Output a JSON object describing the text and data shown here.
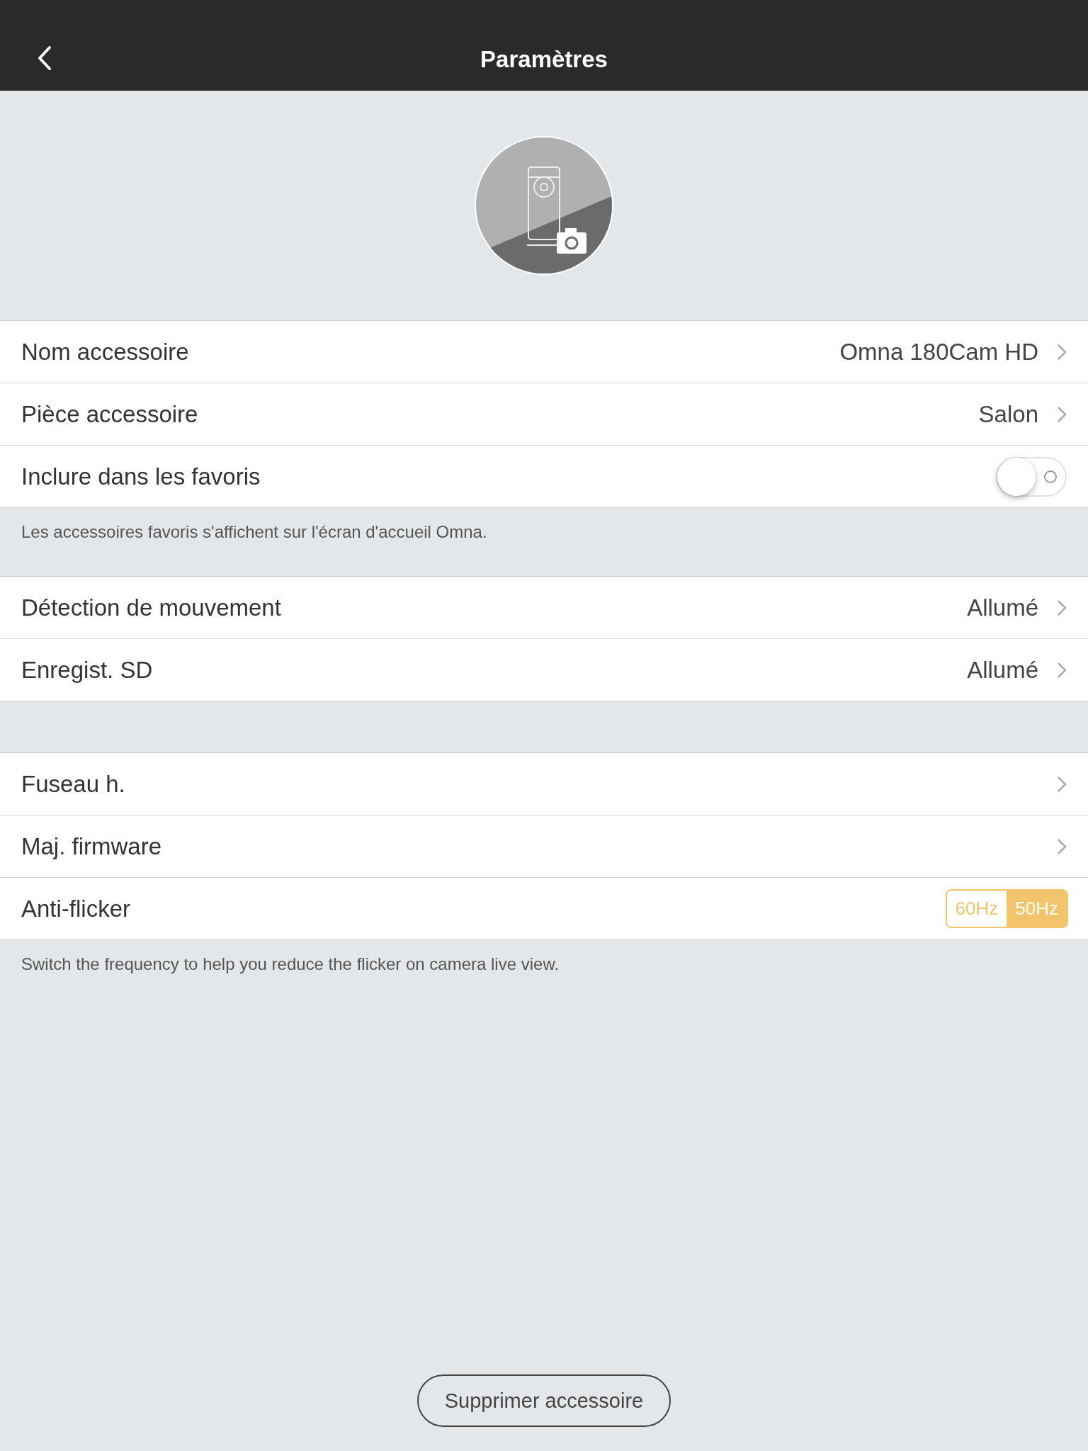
{
  "header": {
    "title": "Paramètres"
  },
  "sections": [
    {
      "rows": [
        {
          "kind": "link",
          "label": "Nom accessoire",
          "value": "Omna 180Cam HD"
        },
        {
          "kind": "link",
          "label": "Pièce accessoire",
          "value": "Salon"
        },
        {
          "kind": "toggle",
          "label": "Inclure dans les favoris",
          "on": false
        }
      ],
      "footer": "Les accessoires favoris s'affichent sur l'écran d'accueil Omna."
    },
    {
      "rows": [
        {
          "kind": "link",
          "label": "Détection de mouvement",
          "value": "Allumé"
        },
        {
          "kind": "link",
          "label": "Enregist. SD",
          "value": "Allumé"
        }
      ]
    },
    {
      "rows": [
        {
          "kind": "link",
          "label": "Fuseau h."
        },
        {
          "kind": "link",
          "label": "Maj. firmware"
        },
        {
          "kind": "segmented",
          "label": "Anti-flicker",
          "options": [
            {
              "label": "60Hz",
              "selected": false
            },
            {
              "label": "50Hz",
              "selected": true
            }
          ]
        }
      ],
      "footer": "Switch the frequency to help you reduce the flicker on camera live view."
    }
  ],
  "delete_button": "Supprimer accessoire"
}
